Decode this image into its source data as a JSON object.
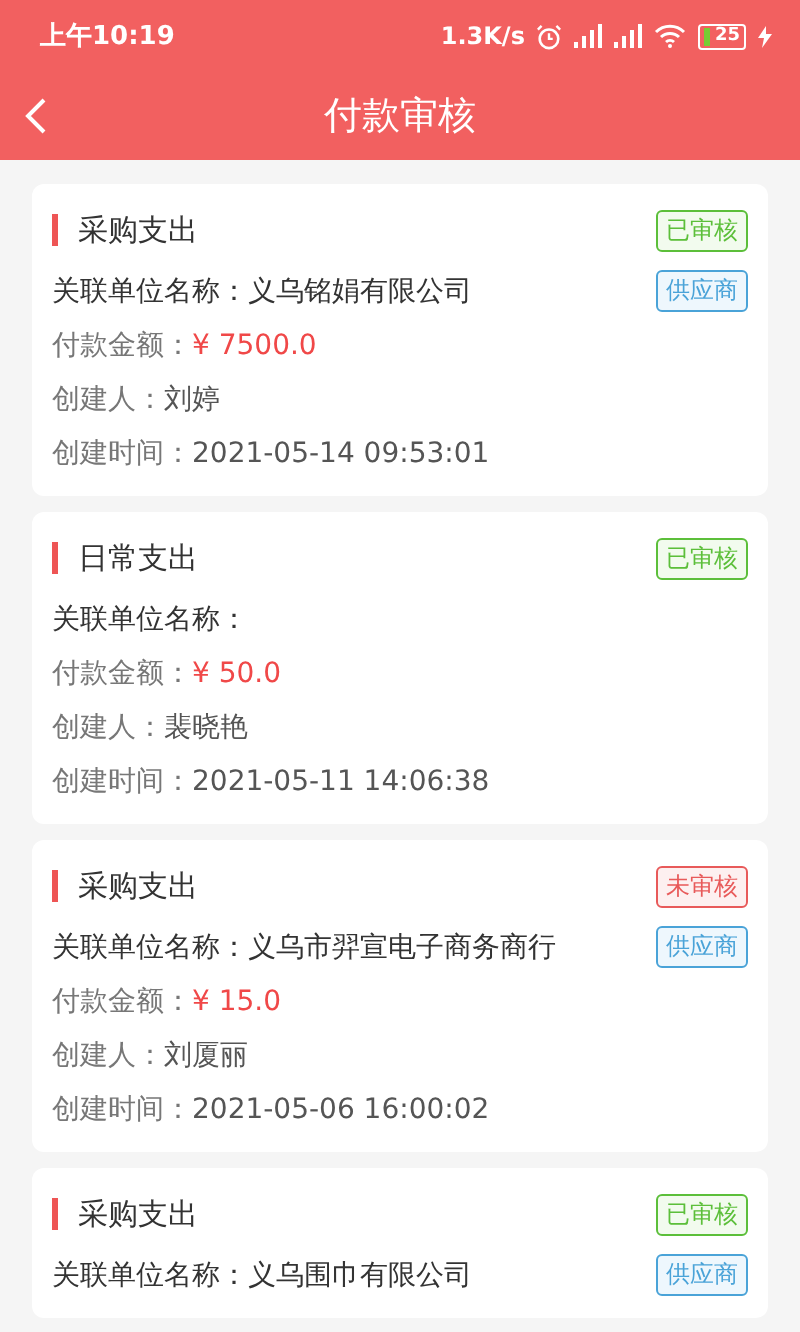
{
  "status_bar": {
    "time": "上午10:19",
    "speed": "1.3K/s",
    "battery": "25"
  },
  "header": {
    "title": "付款审核"
  },
  "records": [
    {
      "category": "采购支出",
      "status": {
        "label": "已审核",
        "kind": "approved"
      },
      "party_tag": "供应商",
      "fields": [
        {
          "label": "关联单位名称：",
          "value": "义乌铭娟有限公司",
          "kind": "plain"
        },
        {
          "label": "付款金额：",
          "value": "¥ 7500.0",
          "kind": "amount"
        },
        {
          "label": "创建人：",
          "value": "刘婷",
          "kind": "plain"
        },
        {
          "label": "创建时间：",
          "value": "2021-05-14 09:53:01",
          "kind": "plain"
        }
      ]
    },
    {
      "category": "日常支出",
      "status": {
        "label": "已审核",
        "kind": "approved"
      },
      "fields": [
        {
          "label": "关联单位名称：",
          "kind": "plain"
        },
        {
          "label": "付款金额：",
          "value": "¥ 50.0",
          "kind": "amount"
        },
        {
          "label": "创建人：",
          "value": "裴晓艳",
          "kind": "plain"
        },
        {
          "label": "创建时间：",
          "value": "2021-05-11 14:06:38",
          "kind": "plain"
        }
      ]
    },
    {
      "category": "采购支出",
      "status": {
        "label": "未审核",
        "kind": "pending"
      },
      "party_tag": "供应商",
      "fields": [
        {
          "label": "关联单位名称：",
          "value": "义乌市羿宣电子商务商行",
          "kind": "plain"
        },
        {
          "label": "付款金额：",
          "value": "¥ 15.0",
          "kind": "amount"
        },
        {
          "label": "创建人：",
          "value": "刘厦丽",
          "kind": "plain"
        },
        {
          "label": "创建时间：",
          "value": "2021-05-06 16:00:02",
          "kind": "plain"
        }
      ]
    },
    {
      "category": "采购支出",
      "status": {
        "label": "已审核",
        "kind": "approved"
      },
      "party_tag": "供应商",
      "fields": [
        {
          "label": "关联单位名称：",
          "value": "义乌围巾有限公司",
          "kind": "plain"
        }
      ]
    }
  ]
}
